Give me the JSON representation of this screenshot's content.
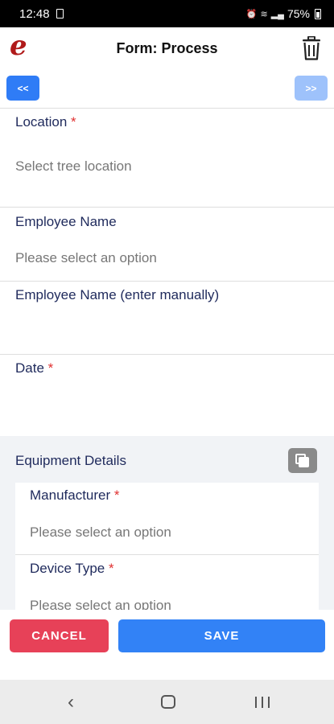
{
  "status_bar": {
    "time": "12:48",
    "battery": "75%"
  },
  "app_bar": {
    "logo": "e",
    "title": "Form: Process"
  },
  "nav": {
    "prev_label": "<<",
    "next_label": ">>"
  },
  "fields": [
    {
      "label": "Location",
      "required": "*",
      "value": "Select tree location"
    },
    {
      "label": "Employee Name",
      "value": "Please select an option"
    },
    {
      "label": "Employee Name (enter manually)",
      "value": ""
    },
    {
      "label": "Date",
      "required": "*",
      "value": ""
    }
  ],
  "equipment_group": {
    "title": "Equipment Details",
    "fields": [
      {
        "label": "Manufacturer",
        "required": "*",
        "value": "Please select an option"
      },
      {
        "label": "Device Type",
        "required": "*",
        "value": "Please select an option"
      }
    ]
  },
  "footer": {
    "cancel_label": "CANCEL",
    "save_label": "SAVE"
  },
  "colors": {
    "primary": "#3282f6",
    "cancel": "#e74158",
    "required": "#e03131",
    "brand": "#b01a1a"
  }
}
